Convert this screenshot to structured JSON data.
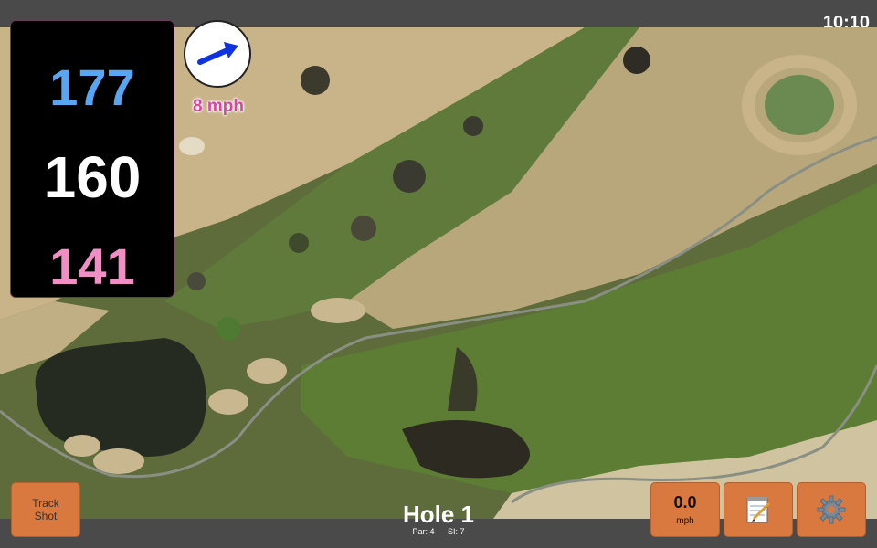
{
  "status_bar": {
    "time": "10:10"
  },
  "yardages": {
    "back": "177",
    "middle": "160",
    "front": "141"
  },
  "wind": {
    "speed": "8 mph",
    "direction_icon": "wind-arrow-icon",
    "arrow_color": "#1033e0"
  },
  "hole": {
    "title": "Hole 1",
    "par": "Par: 4",
    "stroke_index": "SI: 7"
  },
  "buttons": {
    "track_shot_line1": "Track",
    "track_shot_line2": "Shot",
    "speed_value": "0.0",
    "speed_unit": "mph",
    "notes_icon": "notepad-icon",
    "settings_icon": "gear-icon"
  },
  "colors": {
    "button_orange": "#d9793f",
    "back_yardage": "#58a6f2",
    "front_yardage": "#ef8fc4",
    "wind_text": "#d24aa0"
  }
}
